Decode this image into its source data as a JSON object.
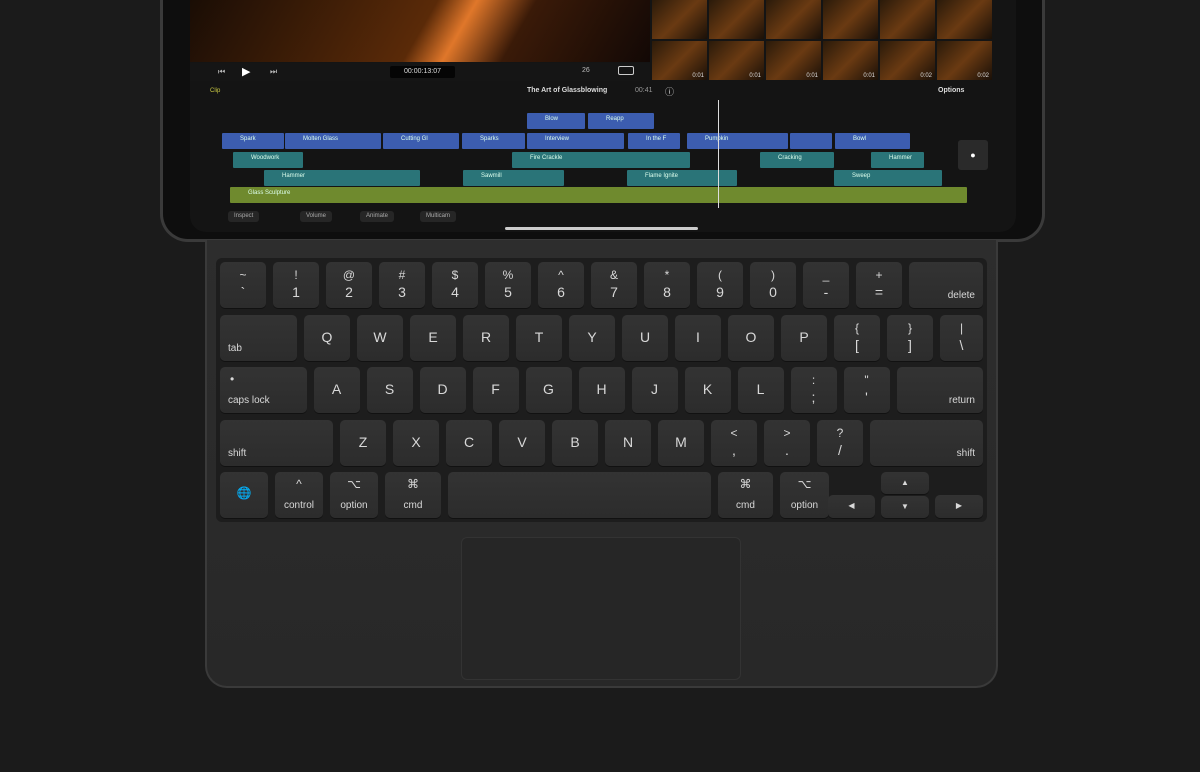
{
  "screen": {
    "timecode": "00:00:13:07",
    "frame_rate": "26",
    "project_title": "The Art of Glassblowing",
    "duration": "00:41",
    "options_label": "Options",
    "clip_label": "Clip",
    "thumb_durations": [
      "0:01",
      "0:01",
      "0:01",
      "0:01",
      "0:02",
      "0:02"
    ],
    "primary_clips": [
      "Spark",
      "Molten Glass",
      "Cutting Gl",
      "Sparks",
      "Interview",
      "In the F",
      "Pumpkin",
      "",
      "Bowl"
    ],
    "connected_clips": [
      "Blow",
      "Reapp"
    ],
    "audio_clips_1": [
      "Woodwork",
      "Fire Crackle",
      "Cracking",
      "Hammer"
    ],
    "audio_clips_2": [
      "Hammer",
      "Sawmill",
      "Flame Ignite",
      "Sweep"
    ],
    "music_clip": "Glass Sculpture",
    "bottom_buttons": [
      "Inspect",
      "Volume",
      "Animate",
      "Multicam"
    ]
  },
  "keyboard": {
    "row1": [
      [
        "~",
        "`"
      ],
      [
        "!",
        "1"
      ],
      [
        "@",
        "2"
      ],
      [
        "#",
        "3"
      ],
      [
        "$",
        "4"
      ],
      [
        "%",
        "5"
      ],
      [
        "^",
        "6"
      ],
      [
        "&",
        "7"
      ],
      [
        "*",
        "8"
      ],
      [
        "(",
        "9"
      ],
      [
        ")",
        "0"
      ],
      [
        "_",
        "-"
      ],
      [
        "+",
        "="
      ],
      [
        "",
        "delete"
      ]
    ],
    "row2": [
      [
        "",
        "tab"
      ],
      [
        "Q"
      ],
      [
        "W"
      ],
      [
        "E"
      ],
      [
        "R"
      ],
      [
        "T"
      ],
      [
        "Y"
      ],
      [
        "U"
      ],
      [
        "I"
      ],
      [
        "O"
      ],
      [
        "P"
      ],
      [
        "{",
        "["
      ],
      [
        "}",
        "]"
      ],
      [
        "|",
        "\\"
      ]
    ],
    "row3": [
      [
        "•",
        "caps lock"
      ],
      [
        "A"
      ],
      [
        "S"
      ],
      [
        "D"
      ],
      [
        "F"
      ],
      [
        "G"
      ],
      [
        "H"
      ],
      [
        "J"
      ],
      [
        "K"
      ],
      [
        "L"
      ],
      [
        ":",
        ";"
      ],
      [
        "\"",
        "'"
      ],
      [
        "",
        "return"
      ]
    ],
    "row4": [
      [
        "",
        "shift"
      ],
      [
        "Z"
      ],
      [
        "X"
      ],
      [
        "C"
      ],
      [
        "V"
      ],
      [
        "B"
      ],
      [
        "N"
      ],
      [
        "M"
      ],
      [
        "<",
        ","
      ],
      [
        ">",
        "."
      ],
      [
        "?",
        "/"
      ],
      [
        "",
        "shift"
      ]
    ],
    "row5": [
      [
        "",
        "🌐"
      ],
      [
        "^",
        "control"
      ],
      [
        "⌥",
        "option"
      ],
      [
        "⌘",
        "cmd"
      ],
      [
        "",
        ""
      ],
      [
        "⌘",
        "cmd"
      ],
      [
        "⌥",
        "option"
      ]
    ],
    "arrows": {
      "left": "◀",
      "up": "▲",
      "down": "▼",
      "right": "▶"
    }
  }
}
